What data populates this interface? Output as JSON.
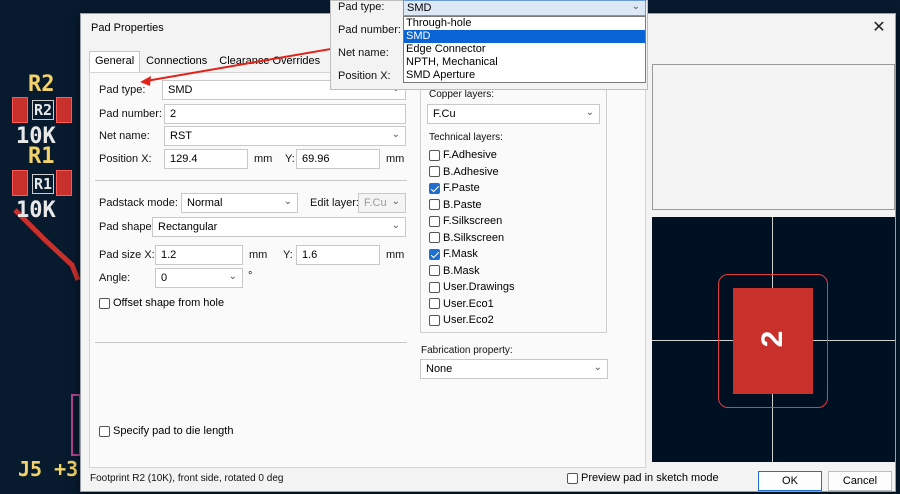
{
  "dialog": {
    "title": "Pad Properties",
    "close_icon": "close-icon"
  },
  "tabs": [
    "General",
    "Connections",
    "Clearance Overrides"
  ],
  "general": {
    "pad_type_label": "Pad type:",
    "pad_type_value": "SMD",
    "pad_number_label": "Pad number:",
    "pad_number_value": "2",
    "net_name_label": "Net name:",
    "net_name_value": "RST",
    "position_x_label": "Position X:",
    "position_x_value": "129.4",
    "position_y_label": "Y:",
    "position_y_value": "69.96",
    "unit": "mm",
    "padstack_mode_label": "Padstack mode:",
    "padstack_mode_value": "Normal",
    "edit_layer_label": "Edit layer:",
    "edit_layer_value": "F.Cu",
    "pad_shape_label": "Pad shape:",
    "pad_shape_value": "Rectangular",
    "pad_size_x_label": "Pad size X:",
    "pad_size_x_value": "1.2",
    "pad_size_y_label": "Y:",
    "pad_size_y_value": "1.6",
    "angle_label": "Angle:",
    "angle_value": "0",
    "angle_unit": "°",
    "offset_shape_label": "Offset shape from hole",
    "specify_die_label": "Specify pad to die length"
  },
  "layers": {
    "copper_label": "Copper layers:",
    "copper_value": "F.Cu",
    "technical_label": "Technical layers:",
    "items": [
      {
        "label": "F.Adhesive",
        "checked": false
      },
      {
        "label": "B.Adhesive",
        "checked": false
      },
      {
        "label": "F.Paste",
        "checked": true
      },
      {
        "label": "B.Paste",
        "checked": false
      },
      {
        "label": "F.Silkscreen",
        "checked": false
      },
      {
        "label": "B.Silkscreen",
        "checked": false
      },
      {
        "label": "F.Mask",
        "checked": true
      },
      {
        "label": "B.Mask",
        "checked": false
      },
      {
        "label": "User.Drawings",
        "checked": false
      },
      {
        "label": "User.Eco1",
        "checked": false
      },
      {
        "label": "User.Eco2",
        "checked": false
      }
    ]
  },
  "fabrication": {
    "label": "Fabrication property:",
    "value": "None"
  },
  "preview": {
    "pad_label": "2",
    "sketch_label": "Preview pad in sketch mode"
  },
  "status": "Footprint R2 (10K), front side, rotated 0 deg",
  "buttons": {
    "ok": "OK",
    "cancel": "Cancel"
  },
  "dropdown": {
    "pad_type_label": "Pad type:",
    "pad_number_label": "Pad number:",
    "net_name_label": "Net name:",
    "position_x_label": "Position X:",
    "selected": "SMD",
    "options": [
      "Through-hole",
      "SMD",
      "Edge Connector",
      "NPTH, Mechanical",
      "SMD Aperture"
    ],
    "selected_index": 1
  },
  "pcb": {
    "r2": "R2",
    "r1": "R1",
    "val1": "10K",
    "val2": "10K",
    "j5": "J5 +3"
  },
  "colors": {
    "accent": "#1f6fd1",
    "pad": "#c8302c",
    "arrow": "#e2231a",
    "board": "#001023"
  }
}
